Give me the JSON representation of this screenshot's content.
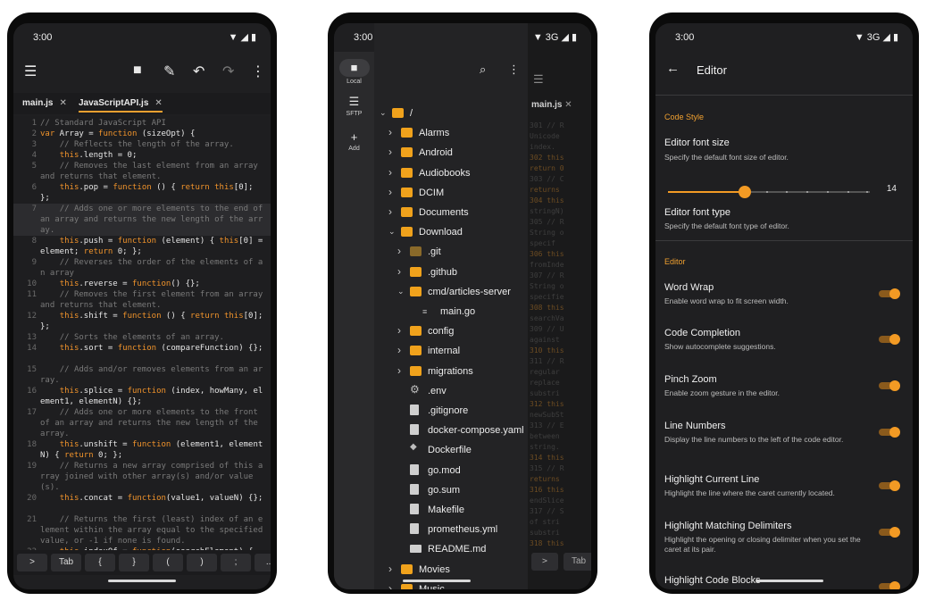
{
  "status": {
    "time": "3:00",
    "network": "3G"
  },
  "editor": {
    "tabs": [
      {
        "label": "main.js"
      },
      {
        "label": "JavaScriptAPI.js"
      }
    ],
    "lines": [
      {
        "n": "1",
        "html": "<span class='c'>// Standard JavaScript API</span>"
      },
      {
        "n": "2",
        "html": "<span class='k'>var</span> Array = <span class='k'>function</span> (sizeOpt) {"
      },
      {
        "n": "3",
        "html": "    <span class='c'>// Reflects the length of the array.</span>"
      },
      {
        "n": "4",
        "html": "    <span class='k'>this</span>.length = 0;"
      },
      {
        "n": "5",
        "html": "    <span class='c'>// Removes the last element from an array and returns that element.</span>"
      },
      {
        "n": "6",
        "html": "    <span class='k'>this</span>.pop = <span class='k'>function</span> () { <span class='k'>return this</span>[0]; };"
      },
      {
        "n": "7",
        "html": "    <span class='c'>// Adds one or more elements to the end of an array and returns the new length of the array.</span>",
        "hl": true
      },
      {
        "n": "8",
        "html": "    <span class='k'>this</span>.push = <span class='k'>function</span> (element) { <span class='k'>this</span>[0] = element; <span class='k'>return</span> 0; };"
      },
      {
        "n": "9",
        "html": "    <span class='c'>// Reverses the order of the elements of an array</span>"
      },
      {
        "n": "10",
        "html": "    <span class='k'>this</span>.reverse = <span class='k'>function</span>() {};"
      },
      {
        "n": "11",
        "html": "    <span class='c'>// Removes the first element from an array and returns that element.</span>"
      },
      {
        "n": "12",
        "html": "    <span class='k'>this</span>.shift = <span class='k'>function</span> () { <span class='k'>return this</span>[0]; };"
      },
      {
        "n": "13",
        "html": "    <span class='c'>// Sorts the elements of an array.</span>"
      },
      {
        "n": "14",
        "html": "    <span class='k'>this</span>.sort = <span class='k'>function</span> (compareFunction) {};"
      },
      {
        "n": "15",
        "html": "    <span class='c'>// Adds and/or removes elements from an array.</span>"
      },
      {
        "n": "16",
        "html": "    <span class='k'>this</span>.splice = <span class='k'>function</span> (index, howMany, element1, elementN) {};"
      },
      {
        "n": "17",
        "html": "    <span class='c'>// Adds one or more elements to the front of an array and returns the new length of the array.</span>"
      },
      {
        "n": "18",
        "html": "    <span class='k'>this</span>.unshift = <span class='k'>function</span> (element1, elementN) { <span class='k'>return</span> 0; };"
      },
      {
        "n": "19",
        "html": "    <span class='c'>// Returns a new array comprised of this array joined with other array(s) and/or value(s).</span>"
      },
      {
        "n": "20",
        "html": "    <span class='k'>this</span>.concat = <span class='k'>function</span>(value1, valueN) {};"
      },
      {
        "n": "21",
        "html": "    <span class='c'>// Returns the first (least) index of an element within the array equal to the specified value, or -1 if none is found.</span>"
      },
      {
        "n": "22",
        "html": "    <span class='k'>this</span>.indexOf = <span class='k'>function</span>(searchElement) {"
      }
    ],
    "keys": [
      ">",
      "Tab",
      "{",
      "}",
      "(",
      ")",
      ";",
      "..."
    ]
  },
  "files": {
    "rail": [
      {
        "label": "Local"
      },
      {
        "label": "SFTP"
      },
      {
        "label": "Add"
      }
    ],
    "tab": "main.js",
    "key_tab": "Tab",
    "tree": [
      {
        "name": "/",
        "kind": "folder",
        "depth": 0,
        "chev": "down"
      },
      {
        "name": "Alarms",
        "kind": "folder",
        "depth": 1,
        "chev": "right"
      },
      {
        "name": "Android",
        "kind": "folder",
        "depth": 1,
        "chev": "right"
      },
      {
        "name": "Audiobooks",
        "kind": "folder",
        "depth": 1,
        "chev": "right"
      },
      {
        "name": "DCIM",
        "kind": "folder",
        "depth": 1,
        "chev": "right"
      },
      {
        "name": "Documents",
        "kind": "folder",
        "depth": 1,
        "chev": "right"
      },
      {
        "name": "Download",
        "kind": "folder",
        "depth": 1,
        "chev": "down"
      },
      {
        "name": ".git",
        "kind": "folder-dim",
        "depth": 2,
        "chev": "right"
      },
      {
        "name": ".github",
        "kind": "folder",
        "depth": 2,
        "chev": "right"
      },
      {
        "name": "cmd/articles-server",
        "kind": "folder",
        "depth": 2,
        "chev": "down"
      },
      {
        "name": "main.go",
        "kind": "go",
        "depth": 3,
        "chev": ""
      },
      {
        "name": "config",
        "kind": "folder",
        "depth": 2,
        "chev": "right"
      },
      {
        "name": "internal",
        "kind": "folder",
        "depth": 2,
        "chev": "right"
      },
      {
        "name": "migrations",
        "kind": "folder",
        "depth": 2,
        "chev": "right"
      },
      {
        "name": ".env",
        "kind": "gear",
        "depth": 2,
        "chev": ""
      },
      {
        "name": ".gitignore",
        "kind": "file",
        "depth": 2,
        "chev": ""
      },
      {
        "name": "docker-compose.yaml",
        "kind": "file",
        "depth": 2,
        "chev": ""
      },
      {
        "name": "Dockerfile",
        "kind": "docker",
        "depth": 2,
        "chev": ""
      },
      {
        "name": "go.mod",
        "kind": "file",
        "depth": 2,
        "chev": ""
      },
      {
        "name": "go.sum",
        "kind": "file",
        "depth": 2,
        "chev": ""
      },
      {
        "name": "Makefile",
        "kind": "file",
        "depth": 2,
        "chev": ""
      },
      {
        "name": "prometheus.yml",
        "kind": "file",
        "depth": 2,
        "chev": ""
      },
      {
        "name": "README.md",
        "kind": "md",
        "depth": 2,
        "chev": ""
      },
      {
        "name": "Movies",
        "kind": "folder",
        "depth": 1,
        "chev": "right"
      },
      {
        "name": "Music",
        "kind": "folder",
        "depth": 1,
        "chev": "right"
      }
    ],
    "bg_lines": [
      "301  // R",
      "     Unicode",
      "     index.",
      "302  this",
      "     return 0",
      "303  // C",
      "     returns",
      "304  this",
      "     stringN)",
      "305  // R",
      "     String o",
      "     specif",
      "306  this",
      "     fromInde",
      "307  // R",
      "     String o",
      "     specifie",
      "308  this",
      "     searchVa",
      "309  // U",
      "     against",
      "310  this",
      "311  // R",
      "     regular",
      "     replace",
      "     substri",
      "312  this",
      "     newSubSt",
      "313  // E",
      "     between",
      "     string.",
      "314  this",
      "315  // R",
      "     returns",
      "316  this",
      "     endSlice",
      "317  // S",
      "     of stri",
      "     substri",
      "318  this"
    ]
  },
  "settings": {
    "title": "Editor",
    "section_code_style": "Code Style",
    "font_size": {
      "title": "Editor font size",
      "desc": "Specify the default font size of editor.",
      "value": "14",
      "level": 0.38
    },
    "font_type": {
      "title": "Editor font type",
      "desc": "Specify the default font type of editor."
    },
    "section_editor": "Editor",
    "toggles": [
      {
        "title": "Word Wrap",
        "desc": "Enable word wrap to fit screen width.",
        "on": true
      },
      {
        "title": "Code Completion",
        "desc": "Show autocomplete suggestions.",
        "on": true
      },
      {
        "title": "Pinch Zoom",
        "desc": "Enable zoom gesture in the editor.",
        "on": true
      },
      {
        "title": "Line Numbers",
        "desc": "Display the line numbers to the left of the code editor.",
        "on": true
      },
      {
        "title": "Highlight Current Line",
        "desc": "Highlight the line where the caret currently located.",
        "on": true
      },
      {
        "title": "Highlight Matching Delimiters",
        "desc": "Highlight the opening or closing delimiter when you set the caret at its pair.",
        "on": true
      },
      {
        "title": "Highlight Code Blocks",
        "desc": "",
        "on": true
      }
    ]
  }
}
